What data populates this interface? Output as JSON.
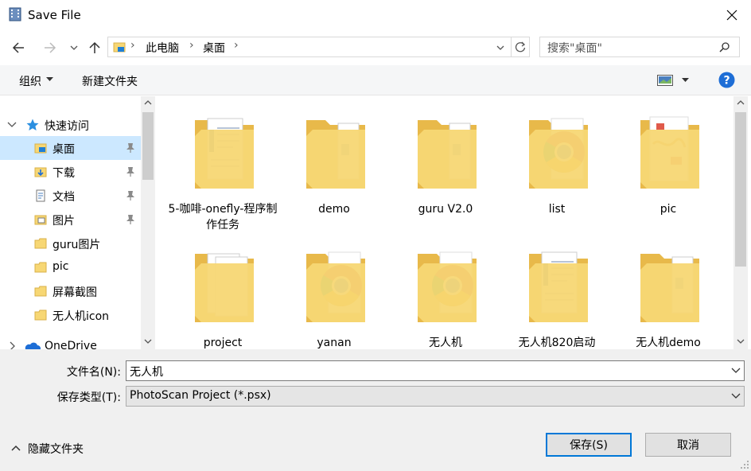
{
  "window": {
    "title": "Save File"
  },
  "address": {
    "crumbs": [
      "此电脑",
      "桌面"
    ]
  },
  "search": {
    "placeholder": "搜索\"桌面\""
  },
  "toolbar": {
    "organize": "组织",
    "new_folder": "新建文件夹"
  },
  "nav": {
    "quick_access": "快速访问",
    "items": [
      {
        "label": "桌面",
        "icon": "desktop-folder-icon",
        "pinned": true,
        "selected": true
      },
      {
        "label": "下载",
        "icon": "download-folder-icon",
        "pinned": true
      },
      {
        "label": "文档",
        "icon": "documents-folder-icon",
        "pinned": true
      },
      {
        "label": "图片",
        "icon": "pictures-folder-icon",
        "pinned": true
      },
      {
        "label": "guru图片",
        "icon": "folder-icon"
      },
      {
        "label": "pic",
        "icon": "folder-icon"
      },
      {
        "label": "屏幕截图",
        "icon": "folder-icon"
      },
      {
        "label": "无人机icon",
        "icon": "folder-icon"
      }
    ],
    "onedrive": "OneDrive"
  },
  "files": [
    {
      "label": "5-咖啡-onefly-程序制作任务",
      "kind": "docs"
    },
    {
      "label": "demo",
      "kind": "folder"
    },
    {
      "label": "guru V2.0",
      "kind": "folder"
    },
    {
      "label": "list",
      "kind": "chrome"
    },
    {
      "label": "pic",
      "kind": "images"
    },
    {
      "label": "project",
      "kind": "pages"
    },
    {
      "label": "yanan",
      "kind": "chrome"
    },
    {
      "label": "无人机",
      "kind": "chrome"
    },
    {
      "label": "无人机820启动",
      "kind": "docs"
    },
    {
      "label": "无人机demo",
      "kind": "folder"
    }
  ],
  "filename": {
    "label": "文件名(N):",
    "value": "无人机"
  },
  "filetype": {
    "label": "保存类型(T):",
    "value": "PhotoScan Project (*.psx)"
  },
  "footer": {
    "hide_folders": "隐藏文件夹",
    "save": "保存(S)",
    "cancel": "取消"
  },
  "colors": {
    "accent": "#0078d7",
    "folder": "#f7d774",
    "selection": "#cce8ff"
  }
}
